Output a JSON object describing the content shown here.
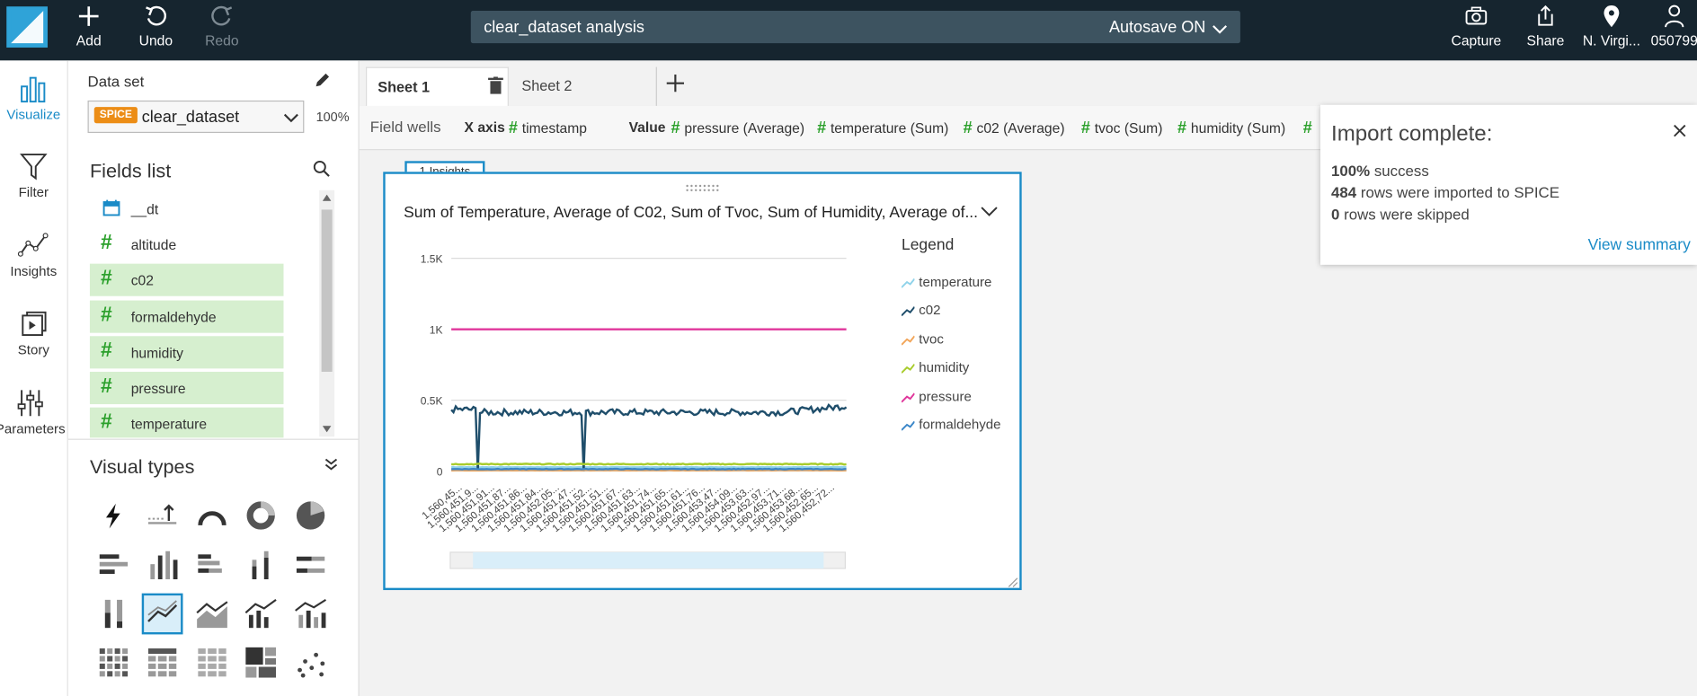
{
  "topbar": {
    "add_label": "Add",
    "undo_label": "Undo",
    "redo_label": "Redo",
    "analysis_title": "clear_dataset analysis",
    "autosave_label": "Autosave ON",
    "capture_label": "Capture",
    "share_label": "Share",
    "region_label": "N. Virgi...",
    "account_label": "050799"
  },
  "rail": {
    "items": [
      {
        "label": "Visualize",
        "icon": "bar-chart-icon",
        "active": true
      },
      {
        "label": "Filter",
        "icon": "funnel-icon"
      },
      {
        "label": "Insights",
        "icon": "insights-icon"
      },
      {
        "label": "Story",
        "icon": "story-icon"
      },
      {
        "label": "Parameters",
        "icon": "sliders-icon"
      }
    ]
  },
  "dataset": {
    "label": "Data set",
    "badge": "SPICE",
    "name": "clear_dataset",
    "percent": "100%"
  },
  "fields": {
    "title": "Fields list",
    "items": [
      {
        "name": "__dt",
        "type": "date"
      },
      {
        "name": "altitude",
        "type": "number"
      },
      {
        "name": "c02",
        "type": "number",
        "selected": true
      },
      {
        "name": "formaldehyde",
        "type": "number",
        "selected": true
      },
      {
        "name": "humidity",
        "type": "number",
        "selected": true
      },
      {
        "name": "pressure",
        "type": "number",
        "selected": true
      },
      {
        "name": "temperature",
        "type": "number",
        "selected": true
      }
    ]
  },
  "visual_types": {
    "title": "Visual types",
    "selected": "line-chart"
  },
  "sheets": {
    "tabs": [
      "Sheet 1",
      "Sheet 2"
    ],
    "active": 0
  },
  "wells": {
    "label": "Field wells",
    "xaxis_label": "X axis",
    "xaxis_field": "timestamp",
    "value_label": "Value",
    "value_fields": [
      "pressure (Average)",
      "temperature (Sum)",
      "c02 (Average)",
      "tvoc (Sum)",
      "humidity (Sum)"
    ]
  },
  "visual": {
    "insights_tab": "1 Insights",
    "title": "Sum of Temperature, Average of C02, Sum of Tvoc, Sum of Humidity, Average of...",
    "legend_title": "Legend"
  },
  "chart_data": {
    "type": "line",
    "title": "Sum of Temperature, Average of C02, Sum of Tvoc, Sum of Humidity, Average of...",
    "ylim": [
      0,
      1500
    ],
    "yticks": [
      "0",
      "0.5K",
      "1K",
      "1.5K"
    ],
    "x_tick_labels": [
      "1,560,45...",
      "1,560,451,9...",
      "1,560,451,91...",
      "1,560,451,87...",
      "1,560,451,86...",
      "1,560,451,84...",
      "1,560,452,05...",
      "1,560,451,47...",
      "1,560,451,52...",
      "1,560,451,51...",
      "1,560,451,67...",
      "1,560,451,63...",
      "1,560,451,74...",
      "1,560,451,65...",
      "1,560,451,61...",
      "1,560,451,76...",
      "1,560,453,47...",
      "1,560,454,09...",
      "1,560,453,63...",
      "1,560,452,97...",
      "1,560,453,71...",
      "1,560,453,68...",
      "1,560,452,65...",
      "1,560,452,72..."
    ],
    "series": [
      {
        "name": "temperature",
        "color": "#8fd3ea",
        "approx_level": 28
      },
      {
        "name": "c02",
        "color": "#1f4e6b",
        "approx_level": 420,
        "dips_to": 0
      },
      {
        "name": "tvoc",
        "color": "#f2a65a",
        "approx_level": 5
      },
      {
        "name": "humidity",
        "color": "#a8cc2c",
        "approx_level": 50
      },
      {
        "name": "pressure",
        "color": "#e0369b",
        "approx_level": 1000
      },
      {
        "name": "formaldehyde",
        "color": "#3a86c8",
        "approx_level": 15
      }
    ],
    "legend_position": "right",
    "grid": true
  },
  "toast": {
    "title": "Import complete:",
    "success_pct": "100%",
    "success_text": "success",
    "rows_count": "484",
    "rows_text": "rows were imported to SPICE",
    "skipped_count": "0",
    "skipped_text": "rows were skipped",
    "link": "View summary"
  }
}
